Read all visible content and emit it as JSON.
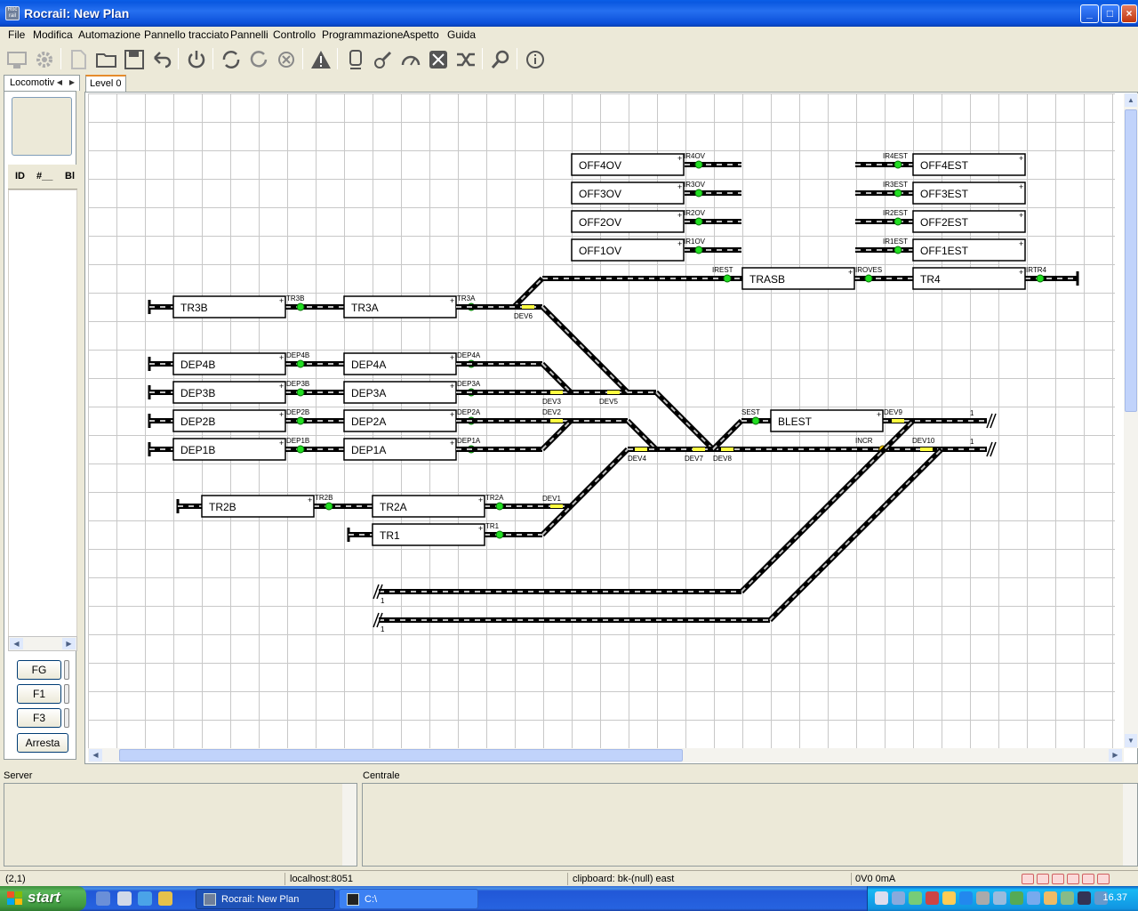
{
  "window": {
    "title": "Rocrail: New Plan",
    "app_icon_text": "Roc rail",
    "minimize": "_",
    "maximize": "□",
    "close": "×"
  },
  "menu": [
    "File",
    "Modifica",
    "Automazione",
    "Pannello tracciato",
    "Pannelli",
    "Controllo",
    "Programmazione",
    "Aspetto",
    "Guida"
  ],
  "left_panel": {
    "tab_label": "Locomotiv",
    "columns": [
      "ID",
      "#__",
      "Bl"
    ],
    "function_buttons": [
      "FG",
      "F1",
      "F3",
      "Arresta"
    ]
  },
  "plan": {
    "tab_label": "Level 0",
    "blocks": [
      {
        "id": "OFF4OV",
        "sensor": "IR4OV"
      },
      {
        "id": "OFF3OV",
        "sensor": "IR3OV"
      },
      {
        "id": "OFF2OV",
        "sensor": "IR2OV"
      },
      {
        "id": "OFF1OV",
        "sensor": "IR1OV"
      },
      {
        "id": "OFF4EST",
        "sensor": "IR4EST"
      },
      {
        "id": "OFF3EST",
        "sensor": "IR3EST"
      },
      {
        "id": "OFF2EST",
        "sensor": "IR2EST"
      },
      {
        "id": "OFF1EST",
        "sensor": "IR1EST"
      },
      {
        "id": "TRASB",
        "sensor": "IREST"
      },
      {
        "id": "TR4",
        "sensor": "IROVES"
      },
      {
        "id": "TR3B",
        "sensor": "TR3B"
      },
      {
        "id": "TR3A",
        "sensor": "TR3A"
      },
      {
        "id": "DEP4B",
        "sensor": "DEP4B"
      },
      {
        "id": "DEP4A",
        "sensor": "DEP4A"
      },
      {
        "id": "DEP3B",
        "sensor": "DEP3B"
      },
      {
        "id": "DEP3A",
        "sensor": "DEP3A"
      },
      {
        "id": "DEP2B",
        "sensor": "DEP2B"
      },
      {
        "id": "DEP2A",
        "sensor": "DEP2A"
      },
      {
        "id": "DEP1B",
        "sensor": "DEP1B"
      },
      {
        "id": "DEP1A",
        "sensor": "DEP1A"
      },
      {
        "id": "BLEST",
        "sensor": "SEST"
      },
      {
        "id": "TR2B",
        "sensor": "TR2B"
      },
      {
        "id": "TR2A",
        "sensor": "TR2A"
      },
      {
        "id": "TR1",
        "sensor": "TR1"
      }
    ],
    "extra_sensors": [
      "IRTR4",
      "INCR"
    ],
    "switches": [
      "DEV1",
      "DEV2",
      "DEV3",
      "DEV4",
      "DEV5",
      "DEV6",
      "DEV7",
      "DEV8",
      "DEV9",
      "DEV10"
    ],
    "connector_label": "1"
  },
  "bottom_panels": {
    "server_label": "Server",
    "central_label": "Centrale"
  },
  "status_bar": {
    "coords": "(2,1)",
    "host": "localhost:8051",
    "clipboard": "clipboard: bk-(null) east",
    "power": "0V0 0mA"
  },
  "taskbar": {
    "start_label": "start",
    "tasks": [
      {
        "label": "Rocrail: New Plan",
        "active": true
      },
      {
        "label": "C:\\",
        "active": false
      }
    ],
    "clock": "16.37"
  },
  "colors": {
    "track": "#000000",
    "track_dash": "#c0c0c0",
    "sensor_on": "#22dd22",
    "switch_marker": "#ffff40",
    "title_blue": "#0a58e0"
  }
}
